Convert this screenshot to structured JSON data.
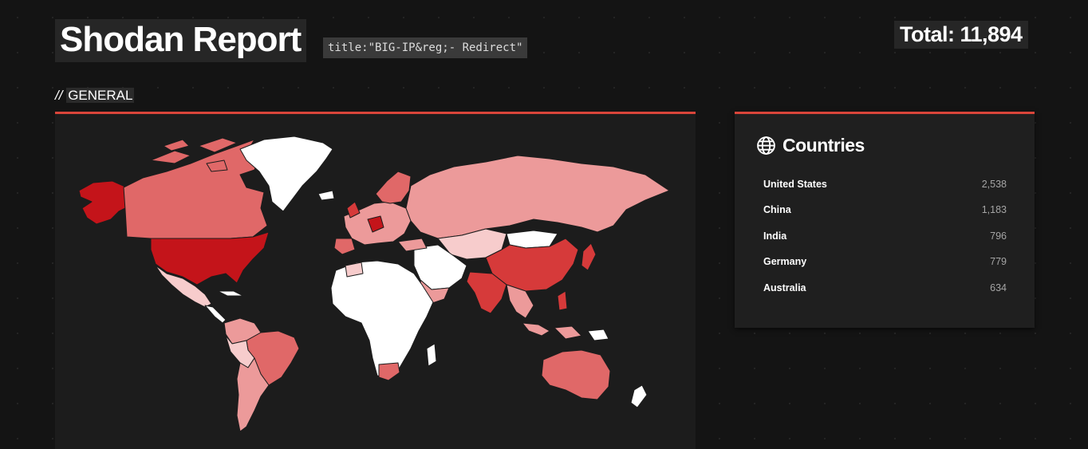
{
  "header": {
    "title": "Shodan Report",
    "query": "title:\"BIG-IP&reg;- Redirect\"",
    "total": "Total: 11,894"
  },
  "section": {
    "prefix": "//",
    "label": "GENERAL"
  },
  "map": {
    "accent": "#d9453a",
    "colors": {
      "highest": "#c4141a",
      "high": "#d63a3a",
      "medium": "#e06868",
      "low": "#ec9a9a",
      "lowest": "#f7cccc",
      "none": "#ffffff",
      "background": "#1c1c1c"
    }
  },
  "countries": {
    "title": "Countries",
    "icon": "globe-icon",
    "items": [
      {
        "name": "United States",
        "count": "2,538"
      },
      {
        "name": "China",
        "count": "1,183"
      },
      {
        "name": "India",
        "count": "796"
      },
      {
        "name": "Germany",
        "count": "779"
      },
      {
        "name": "Australia",
        "count": "634"
      }
    ]
  }
}
